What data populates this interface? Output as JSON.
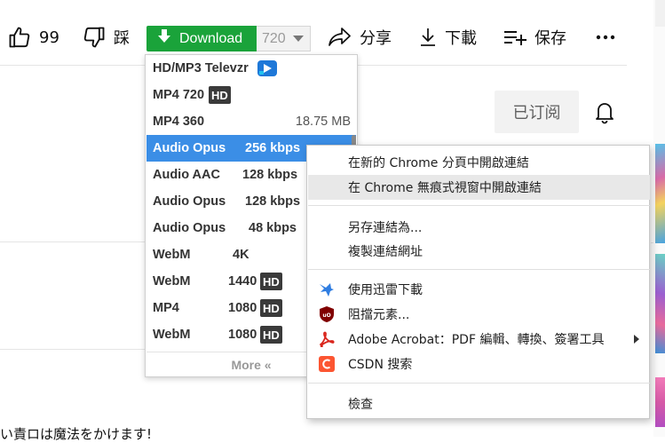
{
  "actions": {
    "like_count": "99",
    "dislike_label": "踩",
    "download_label": "Download",
    "quality_value": "720",
    "share_label": "分享",
    "save_offline_label": "下載",
    "save_label": "保存",
    "more_label": "..."
  },
  "channel": {
    "subscribed_label": "已订阅"
  },
  "bottom_text": "い責ロは魔法をかけます!",
  "download_menu": {
    "items": [
      {
        "c1": "HD/MP3 Televzr",
        "c2": "",
        "badge": "televzr-logo",
        "selected": false
      },
      {
        "c1": "MP4 720",
        "c2": "",
        "badge": "HD",
        "selected": false
      },
      {
        "c1": "MP4 360",
        "c2": "18.75 MB",
        "badge": "",
        "selected": false
      },
      {
        "c1": "Audio Opus",
        "c2": "256 kbps",
        "badge": "",
        "selected": true
      },
      {
        "c1": "Audio AAC",
        "c2": "128 kbps",
        "badge": "",
        "selected": false
      },
      {
        "c1": "Audio Opus",
        "c2": "128 kbps",
        "badge": "",
        "selected": false
      },
      {
        "c1": "Audio Opus",
        "c2": "48 kbps",
        "badge": "",
        "selected": false
      },
      {
        "c1": "WebM",
        "c2": "4K",
        "badge": "",
        "selected": false
      },
      {
        "c1": "WebM",
        "c2": "1440",
        "badge": "HD",
        "selected": false
      },
      {
        "c1": "MP4",
        "c2": "1080",
        "badge": "HD",
        "selected": false
      },
      {
        "c1": "WebM",
        "c2": "1080",
        "badge": "HD",
        "selected": false
      }
    ],
    "more_label": "More «"
  },
  "context_menu": {
    "open_new_tab": "在新的 Chrome 分頁中開啟連結",
    "open_incognito": "在 Chrome 無痕式視窗中開啟連結",
    "save_link_as": "另存連結為...",
    "copy_link": "複製連結網址",
    "thunder_download": "使用迅雷下載",
    "block_element": "阻擋元素...",
    "acrobat": "Adobe Acrobat：PDF 編輯、轉換、簽署工具",
    "csdn_search": "CSDN 搜索",
    "inspect": "檢查"
  },
  "colors": {
    "download_green": "#1aa33a",
    "selected_blue": "#3b8ee6",
    "acrobat_red": "#d9251c",
    "csdn_red": "#fc5531",
    "ublock_red": "#800000"
  }
}
